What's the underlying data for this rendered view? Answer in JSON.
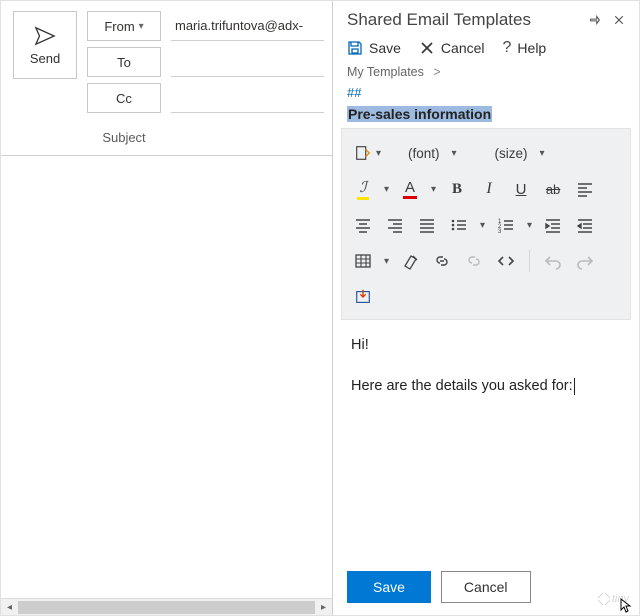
{
  "compose": {
    "send_label": "Send",
    "from_label": "From",
    "to_label": "To",
    "cc_label": "Cc",
    "from_value": "maria.trifuntova@adx-",
    "to_value": "",
    "cc_value": "",
    "subject_label": "Subject",
    "subject_value": ""
  },
  "pane": {
    "title": "Shared Email Templates",
    "save_label": "Save",
    "cancel_label": "Cancel",
    "help_label": "Help",
    "breadcrumb_root": "My Templates",
    "breadcrumb_sep": ">",
    "shortcut": "##",
    "template_name": "Pre-sales information"
  },
  "toolbar": {
    "font_label": "(font)",
    "size_label": "(size)"
  },
  "body": {
    "line1": "Hi!",
    "line2": "Here are the details you asked for:"
  },
  "footer": {
    "save": "Save",
    "cancel": "Cancel",
    "brand": "tiny"
  }
}
